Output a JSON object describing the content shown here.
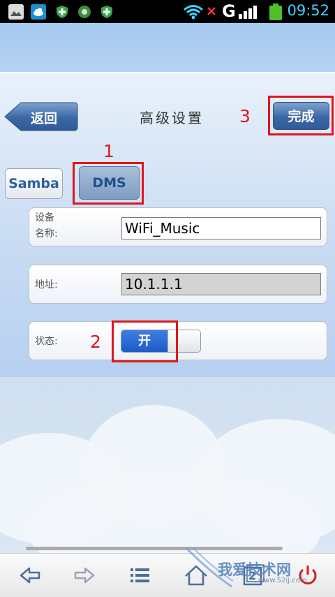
{
  "status_bar": {
    "time": "09:52",
    "network": "G",
    "left_icons": [
      "gallery-icon",
      "cloud-icon",
      "shield-plus-icon",
      "media-icon",
      "shield-plus-icon"
    ],
    "right_icons": [
      "wifi-icon",
      "no-signal-icon",
      "signal-icon",
      "battery-icon"
    ]
  },
  "header": {
    "back_label": "返回",
    "title": "高级设置",
    "done_label": "完成"
  },
  "tabs": [
    {
      "label": "Samba",
      "selected": false
    },
    {
      "label": "DMS",
      "selected": true
    }
  ],
  "form": {
    "device_name_label_line1": "设备",
    "device_name_label_line2": "名称:",
    "device_name_value": "WiFi_Music",
    "address_label": "地址:",
    "address_value": "10.1.1.1",
    "status_label": "状态:",
    "status_toggle_label": "开",
    "status_on": true
  },
  "annotations": {
    "step1": "1",
    "step2": "2",
    "step3": "3",
    "color": "#e0151c"
  },
  "bottom_nav": {
    "items": [
      "back-arrow-icon",
      "forward-arrow-icon",
      "menu-list-icon",
      "home-icon",
      "windows-icon",
      "power-icon"
    ],
    "window_count": "2"
  },
  "watermark": {
    "text": "我爱技术网",
    "sub": "www.52ij.com"
  },
  "colors": {
    "accent": "#2a5fa3",
    "toggle_on": "#1c5ac7",
    "clock": "#3fd3ff"
  }
}
